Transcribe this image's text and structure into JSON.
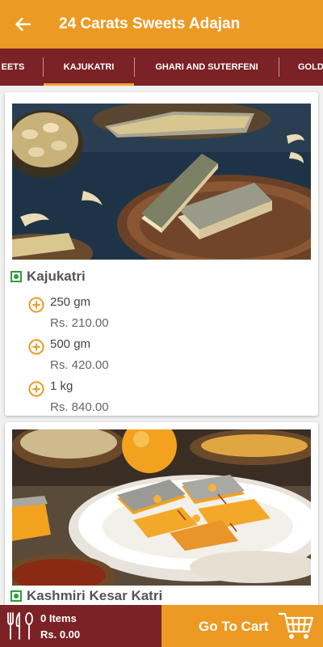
{
  "appbar": {
    "title": "24 Carats Sweets Adajan",
    "back_icon": "arrow-back-icon"
  },
  "tabs": [
    {
      "label": "EETS",
      "active": false
    },
    {
      "label": "KAJUKATRI",
      "active": true
    },
    {
      "label": "GHARI AND SUTERFENI",
      "active": false
    },
    {
      "label": "GOLD",
      "active": false
    }
  ],
  "products": [
    {
      "name": "Kajukatri",
      "veg": true,
      "variants": [
        {
          "size": "250 gm",
          "price": "Rs. 210.00"
        },
        {
          "size": "500 gm",
          "price": "Rs. 420.00"
        },
        {
          "size": "1 kg",
          "price": "Rs. 840.00"
        }
      ]
    },
    {
      "name": "Kashmiri Kesar Katri",
      "veg": true
    }
  ],
  "cart": {
    "items_label": "0 Items",
    "total_label": "Rs. 0.00",
    "button_label": "Go To Cart",
    "cart_icon": "shopping-cart-icon",
    "menu_icon": "cutlery-icon"
  },
  "colors": {
    "primary": "#ec9a23",
    "secondary": "#7b2226",
    "veg_green": "#2e9e3a"
  }
}
